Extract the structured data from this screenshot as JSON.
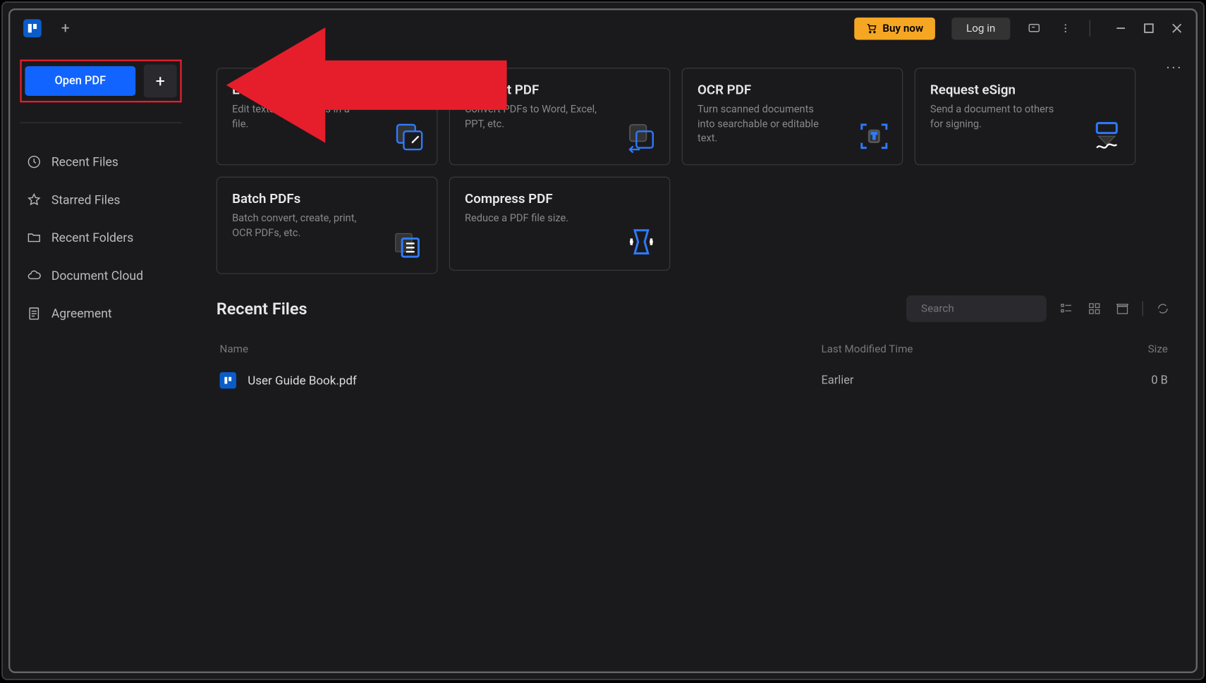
{
  "titlebar": {
    "buy_label": "Buy now",
    "login_label": "Log in"
  },
  "sidebar": {
    "open_pdf_label": "Open PDF",
    "items": [
      {
        "label": "Recent Files"
      },
      {
        "label": "Starred Files"
      },
      {
        "label": "Recent Folders"
      },
      {
        "label": "Document Cloud"
      },
      {
        "label": "Agreement"
      }
    ]
  },
  "quick_tools": [
    {
      "title": "Edit",
      "desc": "Edit texts and images in a file."
    },
    {
      "title": "Convert PDF",
      "desc": "Convert PDFs to Word, Excel, PPT, etc."
    },
    {
      "title": "OCR PDF",
      "desc": "Turn scanned documents into searchable or editable text."
    },
    {
      "title": "Request eSign",
      "desc": "Send a document to others for signing."
    },
    {
      "title": "Batch PDFs",
      "desc": "Batch convert, create, print, OCR PDFs, etc."
    },
    {
      "title": "Compress PDF",
      "desc": "Reduce a PDF file size."
    }
  ],
  "recent": {
    "title": "Recent Files",
    "search_placeholder": "Search",
    "columns": {
      "name": "Name",
      "modified": "Last Modified Time",
      "size": "Size"
    },
    "rows": [
      {
        "name": "User Guide Book.pdf",
        "modified": "Earlier",
        "size": "0 B"
      }
    ]
  }
}
